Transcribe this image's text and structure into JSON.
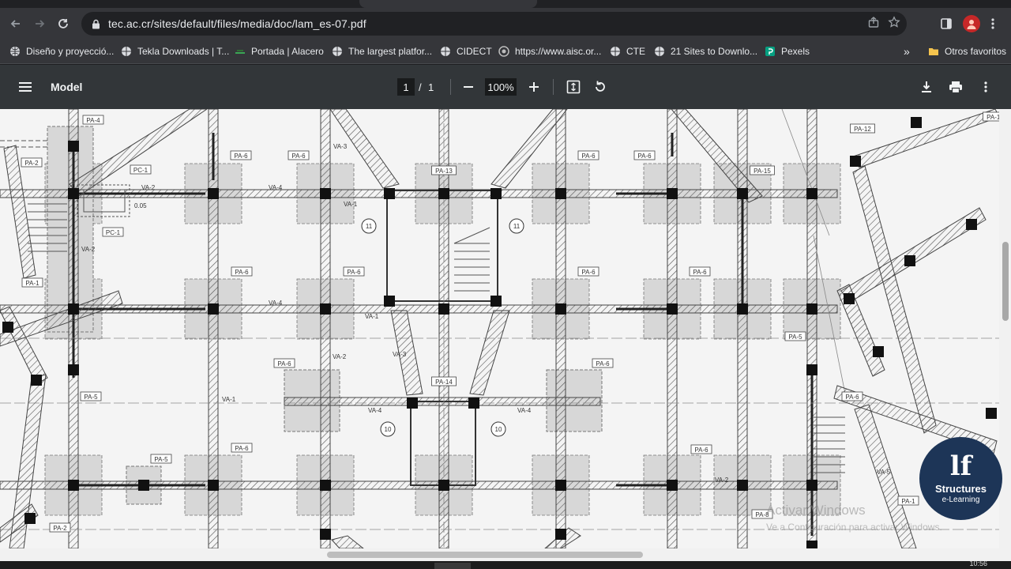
{
  "browser": {
    "url": "tec.ac.cr/sites/default/files/media/doc/lam_es-07.pdf",
    "bookmarks": [
      {
        "label": "Diseño y proyecció...",
        "icon": "globe-icon"
      },
      {
        "label": "Tekla Downloads | T...",
        "icon": "globe-icon"
      },
      {
        "label": "Portada | Alacero",
        "icon": "alacero-icon"
      },
      {
        "label": "The largest platfor...",
        "icon": "globe-icon"
      },
      {
        "label": "CIDECT",
        "icon": "globe-icon"
      },
      {
        "label": "https://www.aisc.or...",
        "icon": "aisc-icon"
      },
      {
        "label": "CTE",
        "icon": "globe-icon"
      },
      {
        "label": "21 Sites to Downlo...",
        "icon": "globe-icon"
      },
      {
        "label": "Pexels",
        "icon": "pexels-icon"
      }
    ],
    "other_bookmarks": "Otros favoritos",
    "overflow_glyph": "»"
  },
  "pdf": {
    "title": "Model",
    "page_current": "1",
    "page_sep": "/",
    "page_total": "1",
    "zoom": "100%"
  },
  "drawing": {
    "tags": [
      "PA-4",
      "PA-6",
      "PA-6",
      "PA-13",
      "PA-6",
      "PA-6",
      "PA-15",
      "PA-12",
      "PA-2",
      "PC-1",
      "PC-1",
      "PA-1",
      "PA-6",
      "PA-6",
      "PA-6",
      "PA-6",
      "PA-6",
      "PA-6",
      "PA-5",
      "PA-5",
      "PA-14",
      "PA-6",
      "PA-5",
      "PA-6",
      "PA-6",
      "PA-1",
      "PA-2",
      "PA-12",
      "PA-8"
    ],
    "beam_labels": [
      "VA-2",
      "VA-4",
      "VA-1",
      "VA-3",
      "VA-2",
      "VA-4",
      "VA-1",
      "VA-2",
      "VA-4",
      "VA-3",
      "VA-1",
      "VA-2",
      "VA-4",
      "VA-5"
    ],
    "dim_label": "0.05",
    "grid_markers": [
      "11",
      "11",
      "10",
      "10"
    ]
  },
  "overlay": {
    "watermark_line1": "Activar Windows",
    "watermark_line2": "Ve a Configuración para activar Windows.",
    "logo_mark": "lf",
    "logo_name": "Structures",
    "logo_sub": "e-Learning",
    "clock": "10:56"
  }
}
